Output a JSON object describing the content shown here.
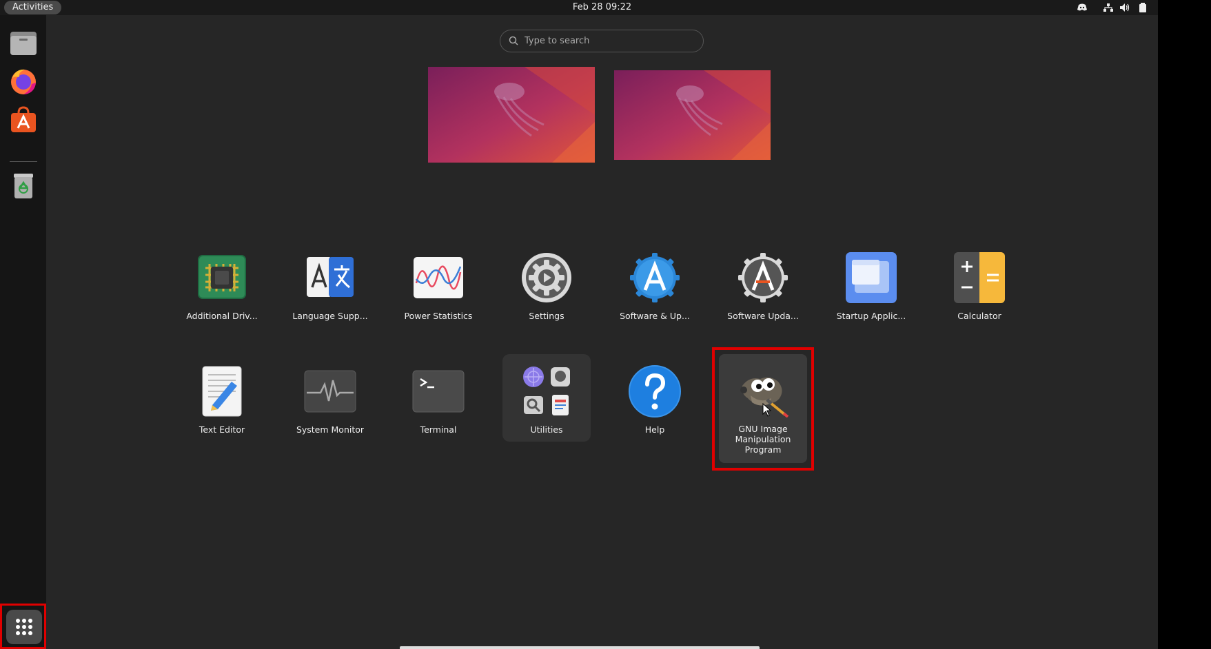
{
  "topbar": {
    "activities_label": "Activities",
    "clock": "Feb 28  09:22",
    "tray_icons": [
      "discord-icon",
      "network-icon",
      "volume-icon",
      "battery-icon"
    ]
  },
  "dock": {
    "items": [
      {
        "name": "Files",
        "icon": "files-icon"
      },
      {
        "name": "Firefox",
        "icon": "firefox-icon"
      },
      {
        "name": "Ubuntu Software",
        "icon": "ubuntu-software-icon"
      },
      {
        "name": "Trash",
        "icon": "trash-icon"
      }
    ],
    "show_apps_icon": "app-grid-icon"
  },
  "search": {
    "placeholder": "Type to search"
  },
  "workspaces": 2,
  "apps": [
    {
      "label": "Additional Driv...",
      "icon": "additional-drivers-icon"
    },
    {
      "label": "Language Supp...",
      "icon": "language-support-icon"
    },
    {
      "label": "Power Statistics",
      "icon": "power-statistics-icon"
    },
    {
      "label": "Settings",
      "icon": "settings-icon"
    },
    {
      "label": "Software & Up...",
      "icon": "software-updates-icon"
    },
    {
      "label": "Software Upda...",
      "icon": "software-updater-icon"
    },
    {
      "label": "Startup Applic...",
      "icon": "startup-applications-icon"
    },
    {
      "label": "Calculator",
      "icon": "calculator-icon"
    },
    {
      "label": "Text Editor",
      "icon": "text-editor-icon"
    },
    {
      "label": "System Monitor",
      "icon": "system-monitor-icon"
    },
    {
      "label": "Terminal",
      "icon": "terminal-icon"
    },
    {
      "label": "Utilities",
      "icon": "utilities-folder-icon"
    },
    {
      "label": "Help",
      "icon": "help-icon"
    },
    {
      "label": "GNU Image Manipulation Program",
      "icon": "gimp-icon"
    }
  ],
  "colors": {
    "background": "#262626",
    "topbar": "#1a1a1a",
    "dock": "#151515",
    "highlight": "#e00000"
  }
}
